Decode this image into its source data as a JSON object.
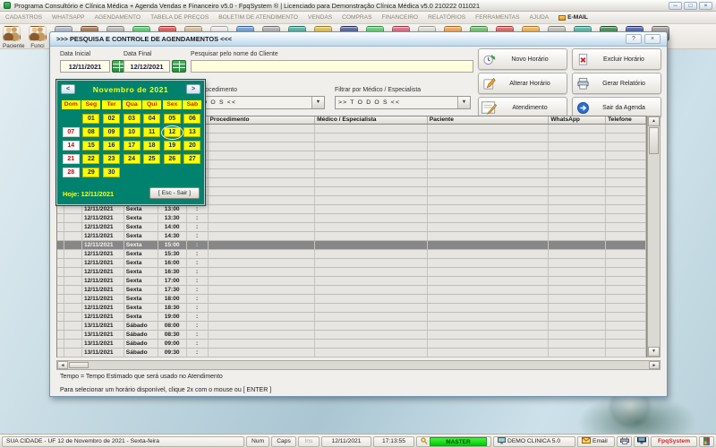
{
  "app": {
    "title": "Programa Consultório e Clínica Médica + Agenda Vendas e Financeiro v5.0 - FpqSystem ® | Licenciado para  Demonstração Clínica Médica v5.0 210222 011021"
  },
  "menu": {
    "items": [
      "CADASTROS",
      "WHATSAPP",
      "AGENDAMENTO",
      "TABELA DE PREÇOS",
      "BOLETIM DE ATENDIMENTO",
      "VENDAS",
      "COMPRAS",
      "FINANCEIRO",
      "RELATÓRIOS",
      "FERRAMENTAS",
      "AJUDA",
      "E-MAIL"
    ]
  },
  "toolbar": {
    "labels": [
      "Paciente",
      "Funci"
    ],
    "icon_colors": [
      "person",
      "person",
      "#9aa8b8",
      "#8a5a30",
      "#a8a8a8",
      "#3dbb57",
      "#cc3333",
      "#c8b088",
      "#e8e8e8",
      "#4a86c8",
      "#9a9a9a",
      "#2a9a8a",
      "#d8b030",
      "#2a3a7a",
      "#3dbb57",
      "#cc4466",
      "#d8d8d0",
      "#e89030",
      "#50b050",
      "#cc4040",
      "#e8a030",
      "#b0b0a8",
      "#30a090",
      "#1a6a30",
      "#223a8a",
      "#888888"
    ]
  },
  "window": {
    "title": ">>>  PESQUISA E CONTROLE DE AGENDAMENTOS  <<<",
    "help_button": "?",
    "close_button": "×",
    "filters": {
      "start_label": "Data Inicial",
      "start_value": "12/11/2021",
      "end_label": "Data Final",
      "end_value": "12/12/2021",
      "search_label": "Pesquisar pelo nome do Cliente",
      "search_value": "",
      "proc_label": "Filtrar por Procedimento",
      "proc_value": ">> T O D O S <<",
      "med_label": "Filtrar por Médico / Especialista",
      "med_value": ">> T O D O S <<"
    },
    "buttons": [
      {
        "label": "Novo Horário",
        "icon": "clock-new-icon"
      },
      {
        "label": "Excluir Horário",
        "icon": "delete-icon"
      },
      {
        "label": "Alterar Horário",
        "icon": "edit-icon"
      },
      {
        "label": "Gerar Relatório",
        "icon": "print-icon"
      },
      {
        "label": "Atendimento",
        "icon": "notepad-icon"
      },
      {
        "label": "Sair da Agenda",
        "icon": "exit-icon"
      }
    ],
    "calendar": {
      "title": "Novembro de 2021",
      "prev": "<",
      "next": ">",
      "day_headers": [
        "Dom",
        "Seg",
        "Ter",
        "Qua",
        "Qui",
        "Sex",
        "Sab"
      ],
      "weeks": [
        [
          "",
          "01",
          "02",
          "03",
          "04",
          "05",
          "06"
        ],
        [
          "07",
          "08",
          "09",
          "10",
          "11",
          "12",
          "13"
        ],
        [
          "14",
          "15",
          "16",
          "17",
          "18",
          "19",
          "20"
        ],
        [
          "21",
          "22",
          "23",
          "24",
          "25",
          "26",
          "27"
        ],
        [
          "28",
          "29",
          "30",
          "",
          "",
          "",
          ""
        ]
      ],
      "selected_day": "12",
      "today_label": "Hoje: 12/11/2021",
      "esc_label": "[ Esc - Sair ]"
    },
    "table": {
      "headers": [
        "",
        "",
        "",
        "",
        "",
        "",
        "Procedimento",
        "Médico / Especialista",
        "Paciente",
        "WhatsApp",
        "Telefone"
      ],
      "empty_leading_rows": 9,
      "rows": [
        {
          "date": "12/11/2021",
          "day": "Sexta",
          "time": "13:00",
          "tempo": ":"
        },
        {
          "date": "12/11/2021",
          "day": "Sexta",
          "time": "13:30",
          "tempo": ":"
        },
        {
          "date": "12/11/2021",
          "day": "Sexta",
          "time": "14:00",
          "tempo": ":"
        },
        {
          "date": "12/11/2021",
          "day": "Sexta",
          "time": "14:30",
          "tempo": ":"
        },
        {
          "date": "12/11/2021",
          "day": "Sexta",
          "time": "15:00",
          "tempo": ":",
          "selected": true
        },
        {
          "date": "12/11/2021",
          "day": "Sexta",
          "time": "15:30",
          "tempo": ":"
        },
        {
          "date": "12/11/2021",
          "day": "Sexta",
          "time": "16:00",
          "tempo": ":"
        },
        {
          "date": "12/11/2021",
          "day": "Sexta",
          "time": "16:30",
          "tempo": ":"
        },
        {
          "date": "12/11/2021",
          "day": "Sexta",
          "time": "17:00",
          "tempo": ":"
        },
        {
          "date": "12/11/2021",
          "day": "Sexta",
          "time": "17:30",
          "tempo": ":"
        },
        {
          "date": "12/11/2021",
          "day": "Sexta",
          "time": "18:00",
          "tempo": ":"
        },
        {
          "date": "12/11/2021",
          "day": "Sexta",
          "time": "18:30",
          "tempo": ":"
        },
        {
          "date": "12/11/2021",
          "day": "Sexta",
          "time": "19:00",
          "tempo": ":"
        },
        {
          "date": "13/11/2021",
          "day": "Sábado",
          "time": "08:00",
          "tempo": ":"
        },
        {
          "date": "13/11/2021",
          "day": "Sábado",
          "time": "08:30",
          "tempo": ":"
        },
        {
          "date": "13/11/2021",
          "day": "Sábado",
          "time": "09:00",
          "tempo": ":"
        },
        {
          "date": "13/11/2021",
          "day": "Sábado",
          "time": "09:30",
          "tempo": ":"
        }
      ]
    },
    "hints": [
      "Tempo = Tempo Estimado que será usado no Atendimento",
      "Para selecionar um horário disponível, clique 2x com o mouse ou [ ENTER ]"
    ]
  },
  "statusbar": {
    "location": "SUA CIDADE - UF 12 de Novembro de 2021 - Sexta-feira",
    "num": "Num",
    "caps": "Caps",
    "ins": "Ins",
    "date": "12/11/2021",
    "time": "17:13:55",
    "user": "MASTER",
    "clinic": "DEMO CLINICA 5.0",
    "email": "Email",
    "brand": "FpqSystem"
  }
}
